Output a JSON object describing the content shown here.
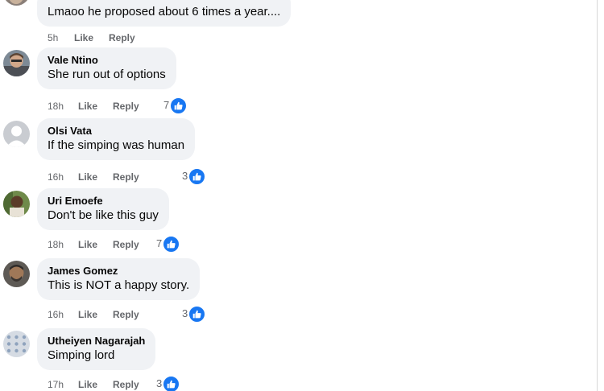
{
  "comments": [
    {
      "author": "",
      "text": "Lmaoo he proposed about 6 times a year....",
      "time": "5h",
      "like_label": "Like",
      "reply_label": "Reply",
      "reactions": "",
      "avatar_icon": "profile-photo"
    },
    {
      "author": "Vale Ntino",
      "text": "She run out of options",
      "time": "18h",
      "like_label": "Like",
      "reply_label": "Reply",
      "reactions": "7",
      "avatar_icon": "profile-photo"
    },
    {
      "author": "Olsi Vata",
      "text": "If the simping was human",
      "time": "16h",
      "like_label": "Like",
      "reply_label": "Reply",
      "reactions": "3",
      "avatar_icon": "default-avatar-icon"
    },
    {
      "author": "Uri Emoefe",
      "text": "Don't be like this guy",
      "time": "18h",
      "like_label": "Like",
      "reply_label": "Reply",
      "reactions": "7",
      "avatar_icon": "profile-photo"
    },
    {
      "author": "James Gomez",
      "text": "This is NOT a happy story.",
      "time": "16h",
      "like_label": "Like",
      "reply_label": "Reply",
      "reactions": "3",
      "avatar_icon": "profile-photo"
    },
    {
      "author": "Utheiyen Nagarajah",
      "text": "Simping lord",
      "time": "17h",
      "like_label": "Like",
      "reply_label": "Reply",
      "reactions": "3",
      "avatar_icon": "profile-photo"
    }
  ],
  "colors": {
    "bubble_bg": "#f0f2f5",
    "text": "#050505",
    "meta": "#65676b",
    "like_blue": "#1877f2"
  }
}
